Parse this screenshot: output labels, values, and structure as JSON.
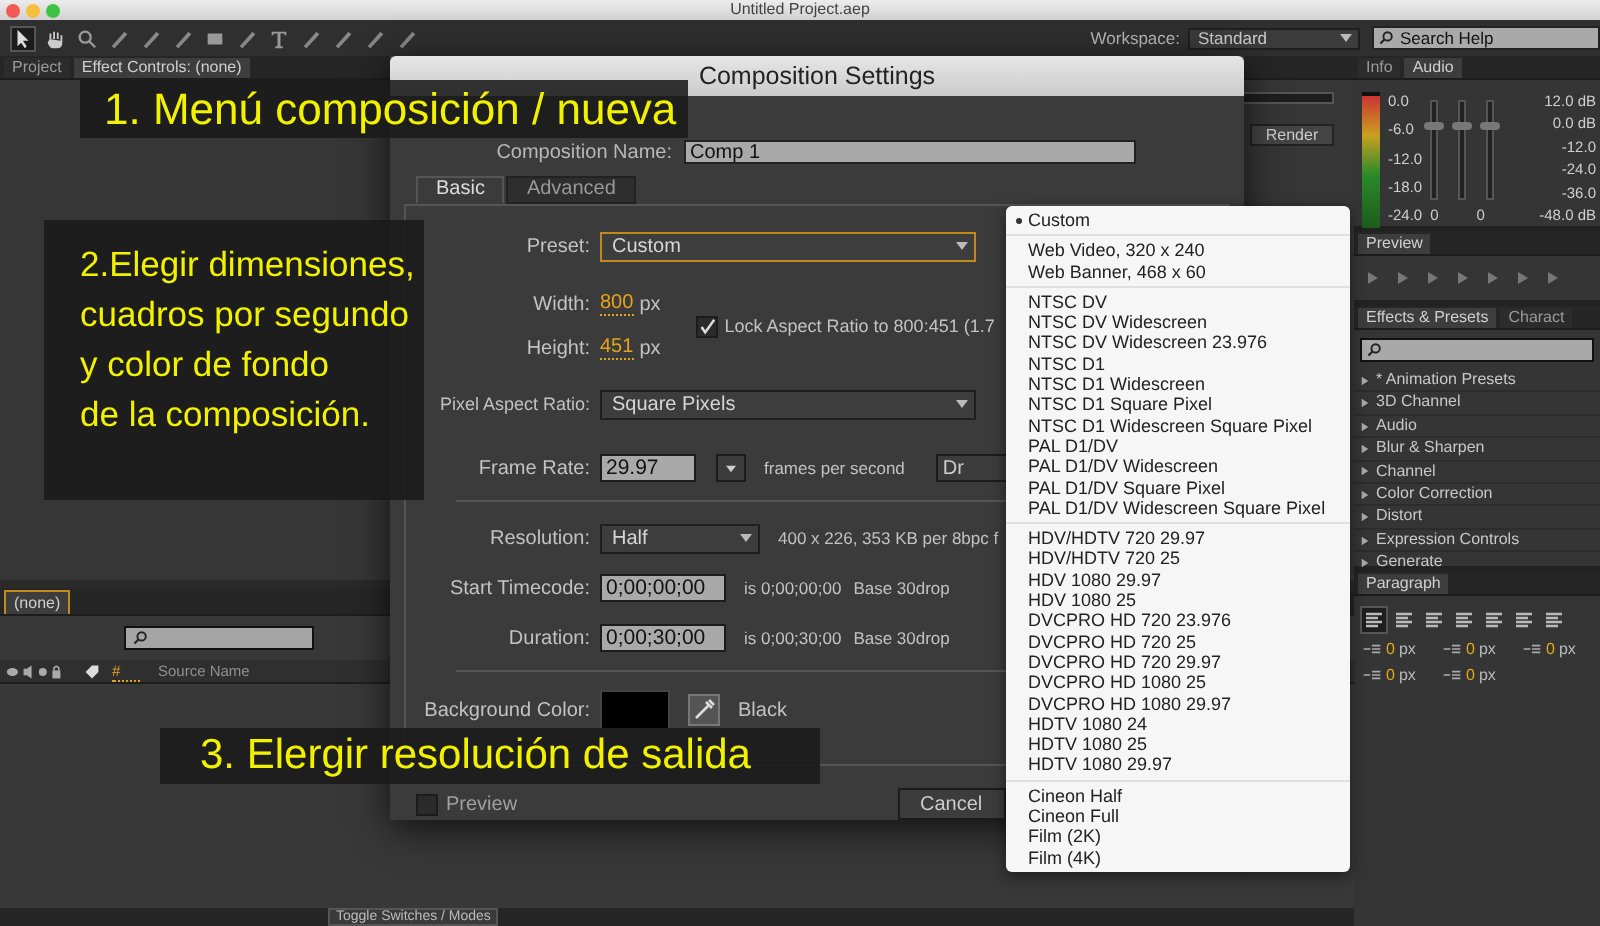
{
  "window": {
    "title": "Untitled Project.aep"
  },
  "toolbar": {
    "workspace_label": "Workspace:",
    "workspace_value": "Standard",
    "search_placeholder": "Search Help"
  },
  "project_panel": {
    "tabs": [
      {
        "label": "Project",
        "selected": false
      },
      {
        "label": "Effect Controls: (none)",
        "selected": true
      }
    ]
  },
  "render_panel": {
    "button": "Render"
  },
  "timeline": {
    "tab": "(none)",
    "columns": [
      "#",
      "Source Name"
    ],
    "toggle_button": "Toggle Switches / Modes"
  },
  "info_panel": {
    "tabs": [
      {
        "label": "Info",
        "selected": false
      },
      {
        "label": "Audio",
        "selected": true
      }
    ],
    "left_scale": [
      "0.0",
      "-6.0",
      "-12.0",
      "-18.0",
      "-24.0"
    ],
    "right_scale": [
      "12.0 dB",
      "0.0 dB",
      "-12.0",
      "-24.0",
      "-36.0",
      "-48.0 dB"
    ],
    "sliders": [
      {
        "level": 0.75
      },
      {
        "level": 0.75
      },
      {
        "level": 0.75
      }
    ],
    "slider_values": [
      "0",
      "0"
    ]
  },
  "preview_panel": {
    "tab": "Preview"
  },
  "effects_panel": {
    "tabs": [
      {
        "label": "Effects & Presets",
        "selected": true
      },
      {
        "label": "Charact",
        "selected": false
      }
    ],
    "items": [
      {
        "label": "* Animation Presets",
        "expanded": false
      },
      {
        "label": "3D Channel",
        "expanded": false
      },
      {
        "label": "Audio",
        "expanded": false
      },
      {
        "label": "Blur & Sharpen",
        "expanded": false
      },
      {
        "label": "Channel",
        "expanded": false
      },
      {
        "label": "Color Correction",
        "expanded": false
      },
      {
        "label": "Distort",
        "expanded": false
      },
      {
        "label": "Expression Controls",
        "expanded": false
      },
      {
        "label": "Generate",
        "expanded": false
      }
    ]
  },
  "paragraph_panel": {
    "tab": "Paragraph",
    "fields": [
      {
        "value": "0",
        "unit": "px"
      },
      {
        "value": "0",
        "unit": "px"
      },
      {
        "value": "0",
        "unit": "px"
      },
      {
        "value": "0",
        "unit": "px"
      },
      {
        "value": "0",
        "unit": "px"
      }
    ]
  },
  "dialog": {
    "title": "Composition Settings",
    "name_label": "Composition Name:",
    "name_value": "Comp 1",
    "tabs": [
      {
        "label": "Basic",
        "selected": true
      },
      {
        "label": "Advanced",
        "selected": false
      }
    ],
    "preset": {
      "label": "Preset:",
      "value": "Custom"
    },
    "width": {
      "label": "Width:",
      "value": "800",
      "unit": "px"
    },
    "height": {
      "label": "Height:",
      "value": "451",
      "unit": "px"
    },
    "lock_aspect": {
      "label": "Lock Aspect Ratio to 800:451 (1.7",
      "checked": true
    },
    "pixel_aspect": {
      "label": "Pixel Aspect Ratio:",
      "value": "Square Pixels"
    },
    "frame_rate": {
      "label": "Frame Rate:",
      "value": "29.97",
      "unit": "frames per second",
      "button": "Dr"
    },
    "resolution": {
      "label": "Resolution:",
      "value": "Half",
      "info": "400 x 226, 353 KB per 8bpc f"
    },
    "timecodes": [
      {
        "label": "Start Timecode:",
        "value": "0;00;00;00",
        "equals": "is 0;00;00;00",
        "base": "Base 30drop"
      },
      {
        "label": "Duration:",
        "value": "0;00;30;00",
        "equals": "is 0;00;30;00",
        "base": "Base 30drop"
      }
    ],
    "background": {
      "label": "Background Color:",
      "name": "Black"
    },
    "preview": {
      "label": "Preview",
      "checked": false
    },
    "cancel": "Cancel"
  },
  "preset_menu": {
    "groups": [
      [
        {
          "label": "Custom",
          "selected": true
        }
      ],
      [
        {
          "label": "Web Video, 320 x 240",
          "selected": false
        },
        {
          "label": "Web Banner, 468 x 60",
          "selected": false
        }
      ],
      [
        {
          "label": "NTSC DV",
          "selected": false
        },
        {
          "label": "NTSC DV Widescreen",
          "selected": false
        },
        {
          "label": "NTSC DV Widescreen 23.976",
          "selected": false
        },
        {
          "label": "NTSC D1",
          "selected": false
        },
        {
          "label": "NTSC D1 Widescreen",
          "selected": false
        },
        {
          "label": "NTSC D1 Square Pixel",
          "selected": false
        },
        {
          "label": "NTSC D1 Widescreen Square Pixel",
          "selected": false
        },
        {
          "label": "PAL D1/DV",
          "selected": false
        },
        {
          "label": "PAL D1/DV Widescreen",
          "selected": false
        },
        {
          "label": "PAL D1/DV Square Pixel",
          "selected": false
        },
        {
          "label": "PAL D1/DV Widescreen Square Pixel",
          "selected": false
        }
      ],
      [
        {
          "label": "HDV/HDTV 720 29.97",
          "selected": false
        },
        {
          "label": "HDV/HDTV 720 25",
          "selected": false
        },
        {
          "label": "HDV 1080 29.97",
          "selected": false
        },
        {
          "label": "HDV 1080 25",
          "selected": false
        },
        {
          "label": "DVCPRO HD 720 23.976",
          "selected": false
        },
        {
          "label": "DVCPRO HD 720 25",
          "selected": false
        },
        {
          "label": "DVCPRO HD 720 29.97",
          "selected": false
        },
        {
          "label": "DVCPRO HD 1080 25",
          "selected": false
        },
        {
          "label": "DVCPRO HD 1080 29.97",
          "selected": false
        },
        {
          "label": "HDTV 1080 24",
          "selected": false
        },
        {
          "label": "HDTV 1080 25",
          "selected": false
        },
        {
          "label": "HDTV 1080 29.97",
          "selected": false
        }
      ],
      [
        {
          "label": "Cineon Half",
          "selected": false
        },
        {
          "label": "Cineon Full",
          "selected": false
        },
        {
          "label": "Film (2K)",
          "selected": false
        },
        {
          "label": "Film (4K)",
          "selected": false
        }
      ]
    ]
  },
  "captions": [
    {
      "kind": "step1",
      "lines": [
        "1. Menú composición / nueva"
      ]
    },
    {
      "kind": "step2",
      "lines": [
        "2.Elegir dimensiones,",
        "cuadros por segundo",
        "y color de fondo",
        "de la composición."
      ]
    },
    {
      "kind": "step3",
      "lines": [
        "3. Elergir resolución de salida"
      ]
    }
  ]
}
